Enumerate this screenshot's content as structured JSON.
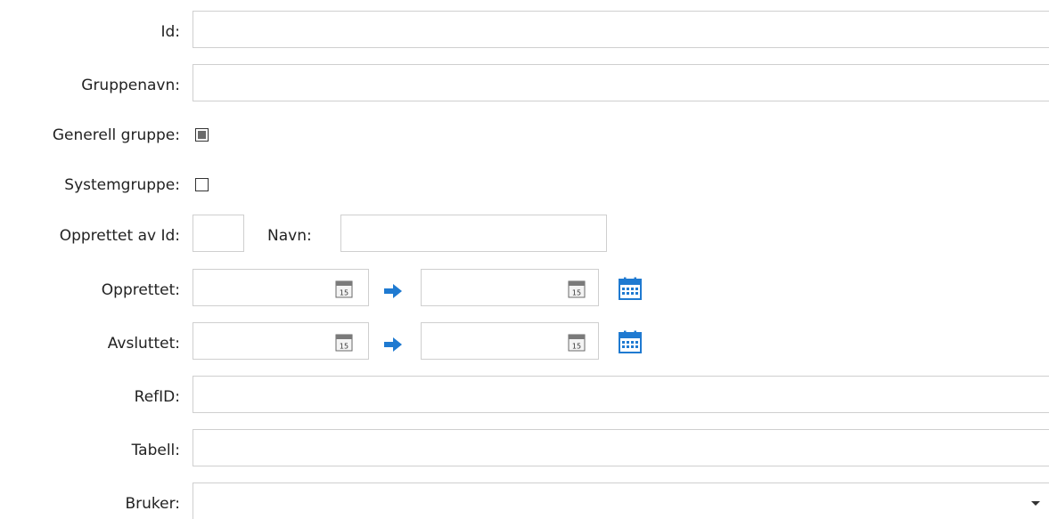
{
  "fields": {
    "id": {
      "label": "Id:",
      "value": ""
    },
    "group_name": {
      "label": "Gruppenavn:",
      "value": ""
    },
    "general_group": {
      "label": "Generell gruppe:",
      "state": "indeterminate"
    },
    "system_group": {
      "label": "Systemgruppe:",
      "state": "unchecked"
    },
    "created_by": {
      "label": "Opprettet av Id:",
      "id_value": "",
      "name_label": "Navn:",
      "name_value": ""
    },
    "created": {
      "label": "Opprettet:",
      "from": "",
      "to": ""
    },
    "ended": {
      "label": "Avsluttet:",
      "from": "",
      "to": ""
    },
    "ref_id": {
      "label": "RefID:",
      "value": ""
    },
    "table": {
      "label": "Tabell:",
      "value": ""
    },
    "user": {
      "label": "Bruker:",
      "value": ""
    }
  },
  "icons": {
    "calendar_day": "15",
    "calendar_icon": "calendar-icon",
    "arrow_icon": "arrow-right-icon",
    "range_icon": "calendar-range-icon",
    "dropdown_icon": "chevron-down-icon",
    "accent_color": "#1f7ad1"
  }
}
